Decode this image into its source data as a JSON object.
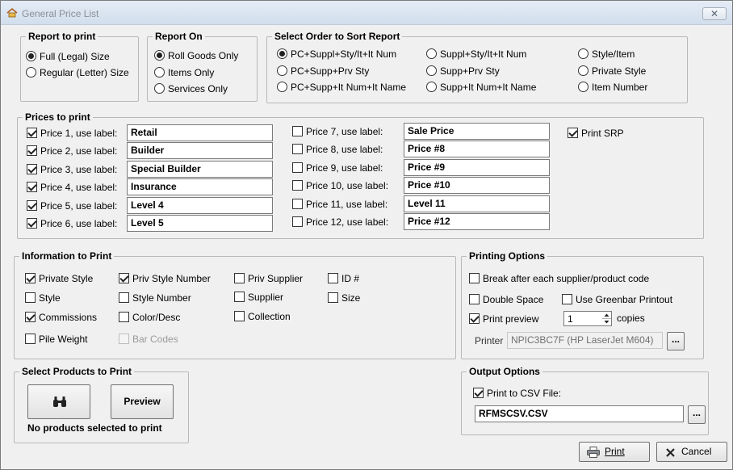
{
  "window": {
    "title": "General Price List",
    "close_label": "✕"
  },
  "report_to_print": {
    "legend": "Report to print",
    "options": [
      {
        "label": "Full (Legal) Size",
        "selected": true
      },
      {
        "label": "Regular (Letter) Size",
        "selected": false
      }
    ]
  },
  "report_on": {
    "legend": "Report On",
    "options": [
      {
        "label": "Roll Goods Only",
        "selected": true
      },
      {
        "label": "Items Only",
        "selected": false
      },
      {
        "label": "Services Only",
        "selected": false
      }
    ]
  },
  "sort_order": {
    "legend": "Select Order to Sort Report",
    "options": [
      {
        "label": "PC+Suppl+Sty/It+It Num",
        "selected": true
      },
      {
        "label": "PC+Supp+Prv Sty",
        "selected": false
      },
      {
        "label": "PC+Supp+It Num+It Name",
        "selected": false
      },
      {
        "label": "Suppl+Sty/It+It Num",
        "selected": false
      },
      {
        "label": "Supp+Prv Sty",
        "selected": false
      },
      {
        "label": "Supp+It Num+It Name",
        "selected": false
      },
      {
        "label": "Style/Item",
        "selected": false
      },
      {
        "label": "Private Style",
        "selected": false
      },
      {
        "label": "Item Number",
        "selected": false
      }
    ]
  },
  "prices": {
    "legend": "Prices to print",
    "rows": [
      {
        "label": "Price 1, use label:",
        "checked": true,
        "value": "Retail"
      },
      {
        "label": "Price 2, use label:",
        "checked": true,
        "value": "Builder"
      },
      {
        "label": "Price 3, use label:",
        "checked": true,
        "value": "Special Builder"
      },
      {
        "label": "Price 4, use label:",
        "checked": true,
        "value": "Insurance"
      },
      {
        "label": "Price 5, use label:",
        "checked": true,
        "value": "Level 4"
      },
      {
        "label": "Price 6, use label:",
        "checked": true,
        "value": "Level 5"
      },
      {
        "label": "Price 7, use label:",
        "checked": false,
        "value": "Sale Price"
      },
      {
        "label": "Price 8, use label:",
        "checked": false,
        "value": "Price #8"
      },
      {
        "label": "Price 9, use label:",
        "checked": false,
        "value": "Price #9"
      },
      {
        "label": "Price 10, use label:",
        "checked": false,
        "value": "Price #10"
      },
      {
        "label": "Price 11, use label:",
        "checked": false,
        "value": "Level 11"
      },
      {
        "label": "Price 12, use label:",
        "checked": false,
        "value": "Price #12"
      }
    ],
    "print_srp": {
      "label": "Print SRP",
      "checked": true
    }
  },
  "info": {
    "legend": "Information to Print",
    "items": [
      {
        "label": "Private Style",
        "checked": true,
        "disabled": false
      },
      {
        "label": "Style",
        "checked": false,
        "disabled": false
      },
      {
        "label": "Commissions",
        "checked": true,
        "disabled": false
      },
      {
        "label": "Pile Weight",
        "checked": false,
        "disabled": false
      },
      {
        "label": "Priv Style Number",
        "checked": true,
        "disabled": false
      },
      {
        "label": "Style Number",
        "checked": false,
        "disabled": false
      },
      {
        "label": "Color/Desc",
        "checked": false,
        "disabled": false
      },
      {
        "label": "Bar Codes",
        "checked": false,
        "disabled": true
      },
      {
        "label": "Priv Supplier",
        "checked": false,
        "disabled": false
      },
      {
        "label": "Supplier",
        "checked": false,
        "disabled": false
      },
      {
        "label": "Collection",
        "checked": false,
        "disabled": false
      },
      {
        "label": "ID #",
        "checked": false,
        "disabled": false
      },
      {
        "label": "Size",
        "checked": false,
        "disabled": false
      }
    ]
  },
  "printing": {
    "legend": "Printing Options",
    "break_each": {
      "label": "Break after each supplier/product code",
      "checked": false
    },
    "double_space": {
      "label": "Double Space",
      "checked": false
    },
    "greenbar": {
      "label": "Use Greenbar Printout",
      "checked": false
    },
    "preview": {
      "label": "Print preview",
      "checked": true
    },
    "copies_value": "1",
    "copies_label": "copies",
    "printer_label": "Printer",
    "printer_value": "NPIC3BC7F (HP LaserJet M604)",
    "browse_label": "..."
  },
  "select_products": {
    "legend": "Select Products to Print",
    "preview_label": "Preview",
    "status": "No products selected to print"
  },
  "output": {
    "legend": "Output Options",
    "csv": {
      "label": "Print to CSV File:",
      "checked": true
    },
    "file_value": "RFMSCSV.CSV",
    "browse_label": "..."
  },
  "buttons": {
    "print_label": "Print",
    "cancel_label": "Cancel"
  }
}
